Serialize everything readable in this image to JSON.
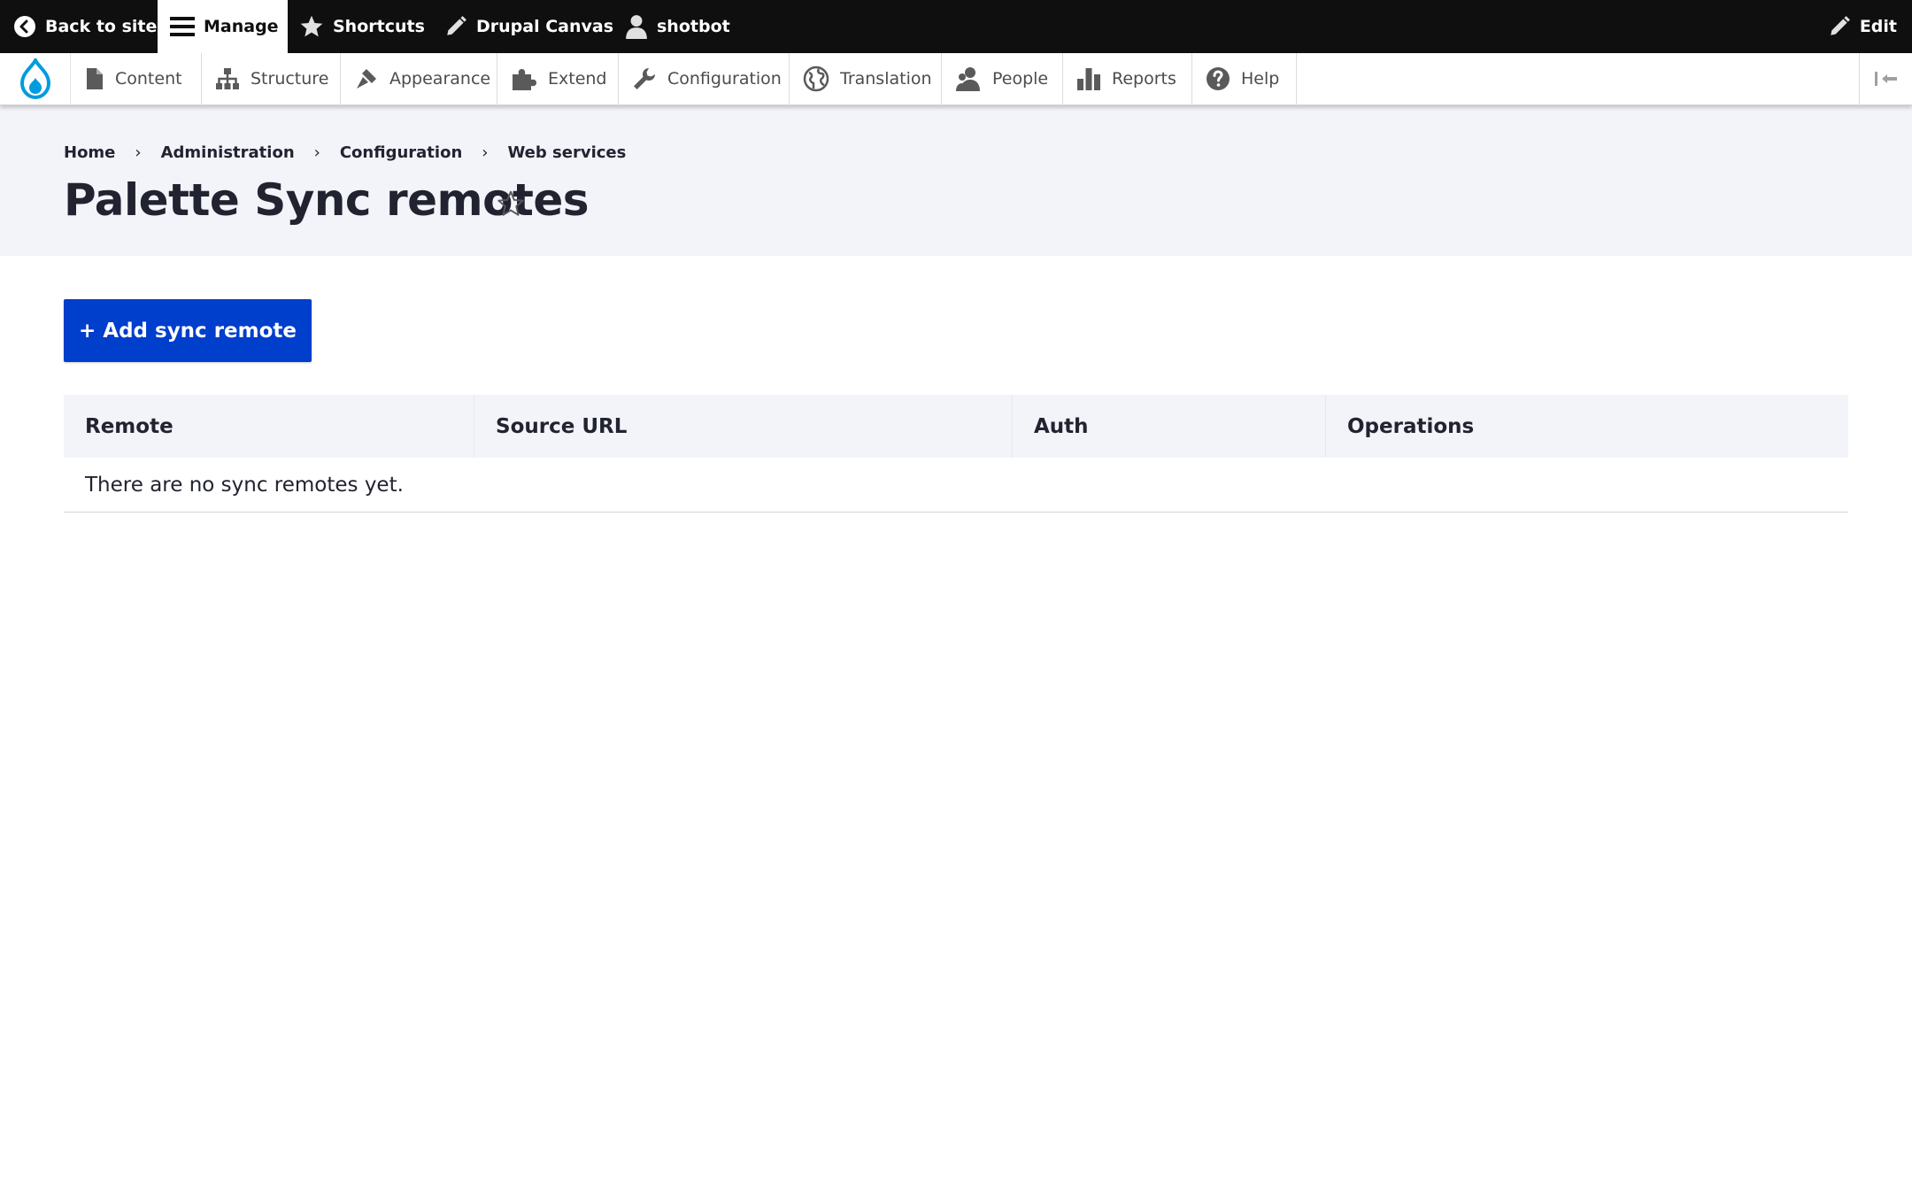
{
  "toolbar": {
    "back_label": "Back to site",
    "manage_label": "Manage",
    "shortcuts_label": "Shortcuts",
    "canvas_label": "Drupal Canvas",
    "user_label": "shotbot",
    "edit_label": "Edit"
  },
  "tray": {
    "items": [
      {
        "label": "Content",
        "icon": "file-icon"
      },
      {
        "label": "Structure",
        "icon": "sitemap-icon"
      },
      {
        "label": "Appearance",
        "icon": "paintbrush-icon"
      },
      {
        "label": "Extend",
        "icon": "puzzle-icon"
      },
      {
        "label": "Configuration",
        "icon": "wrench-icon"
      },
      {
        "label": "Translation",
        "icon": "globe-icon"
      },
      {
        "label": "People",
        "icon": "people-icon"
      },
      {
        "label": "Reports",
        "icon": "bar-chart-icon"
      },
      {
        "label": "Help",
        "icon": "help-icon"
      }
    ]
  },
  "breadcrumb": [
    "Home",
    "Administration",
    "Configuration",
    "Web services"
  ],
  "page": {
    "title": "Palette Sync remotes",
    "add_button": "+ Add sync remote"
  },
  "table": {
    "headers": [
      "Remote",
      "Source URL",
      "Auth",
      "Operations"
    ],
    "empty_message": "There are no sync remotes yet."
  },
  "colors": {
    "toolbar_bg": "#0f0f0f",
    "header_bg": "#f3f4f9",
    "primary_button": "#003ecc",
    "drupal_blue": "#009cde"
  }
}
